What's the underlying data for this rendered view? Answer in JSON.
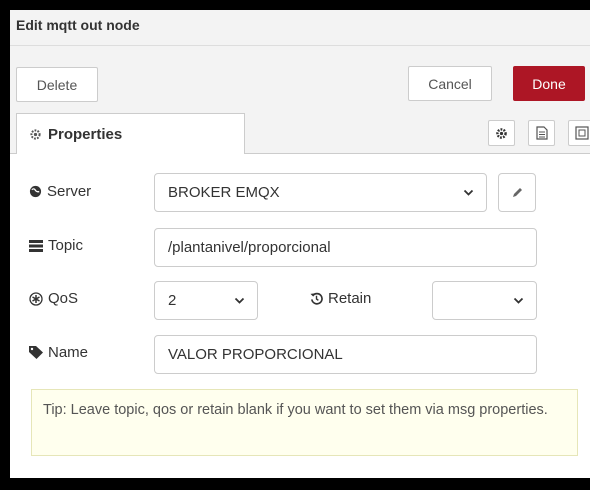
{
  "dialog": {
    "title": "Edit mqtt out node",
    "delete_label": "Delete",
    "cancel_label": "Cancel",
    "done_label": "Done",
    "accent_color": "#ad1625"
  },
  "tabs": {
    "active_label": "Properties",
    "icons": [
      "gear-icon",
      "document-icon",
      "appearance-icon"
    ]
  },
  "form": {
    "server": {
      "label": "Server",
      "value": "BROKER EMQX",
      "icon": "globe-icon"
    },
    "topic": {
      "label": "Topic",
      "value": "/plantanivel/proporcional",
      "icon": "tasks-icon"
    },
    "qos": {
      "label": "QoS",
      "value": "2",
      "icon": "asterisk-icon"
    },
    "retain": {
      "label": "Retain",
      "value": "",
      "icon": "history-icon"
    },
    "name": {
      "label": "Name",
      "value": "VALOR PROPORCIONAL",
      "icon": "tag-icon"
    }
  },
  "tip": {
    "text": "Tip: Leave topic, qos or retain blank if you want to set them via msg properties."
  }
}
